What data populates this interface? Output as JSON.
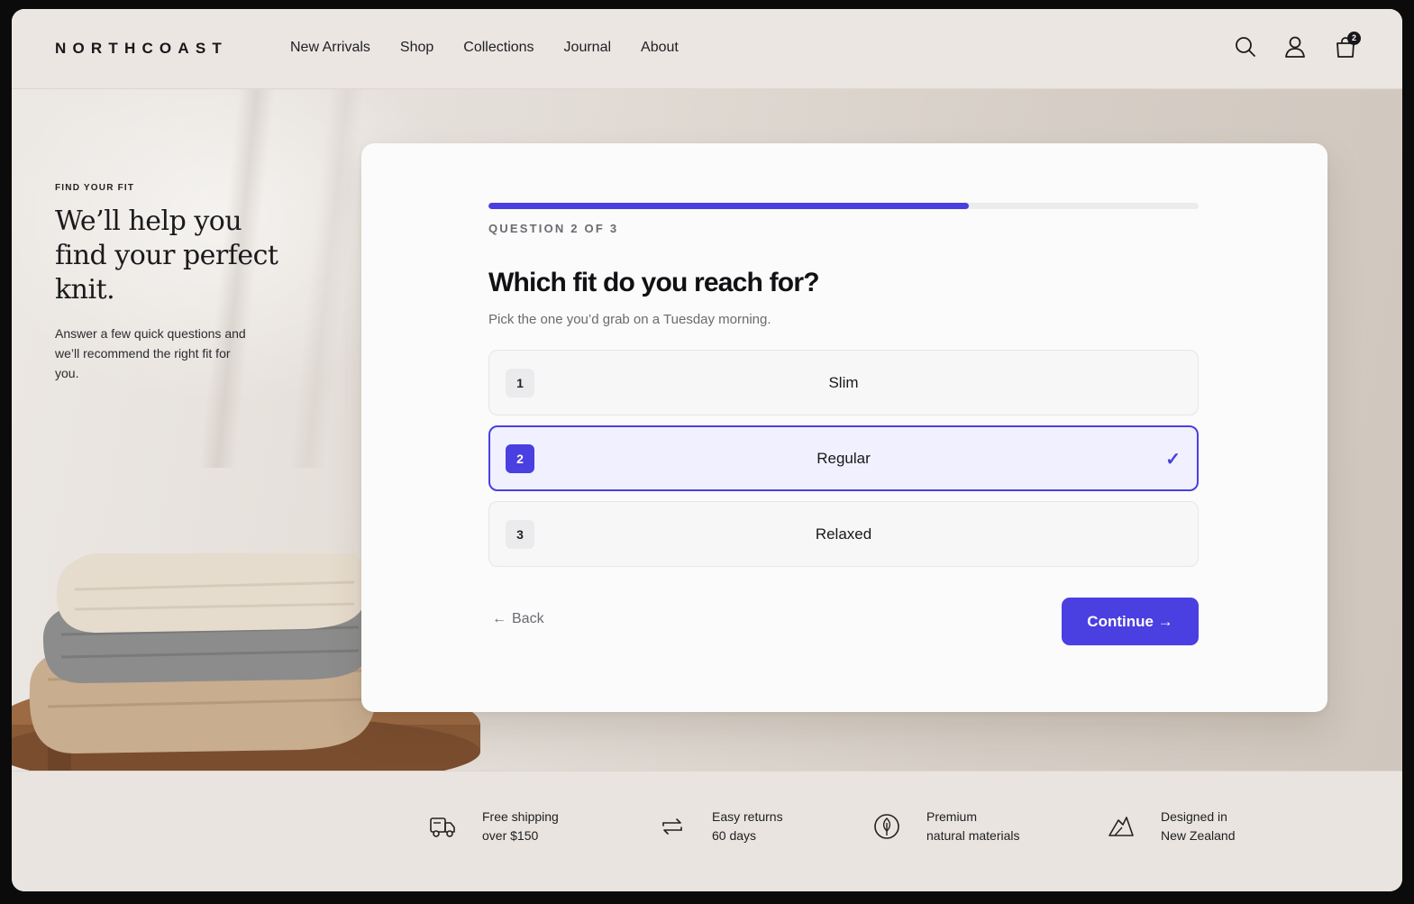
{
  "brand": {
    "logo": "NORTHCOAST"
  },
  "nav": {
    "items": [
      {
        "label": "New Arrivals"
      },
      {
        "label": "Shop"
      },
      {
        "label": "Collections"
      },
      {
        "label": "Journal"
      },
      {
        "label": "About"
      }
    ]
  },
  "header_icons": {
    "search": "search-icon",
    "account": "user-icon",
    "cart": "shopping-bag-icon",
    "cart_count": "2"
  },
  "intro": {
    "eyebrow": "FIND YOUR FIT",
    "title": "We’ll help you find your perfect knit.",
    "text": "Answer a few quick questions and we’ll recommend the right fit for you."
  },
  "quiz": {
    "progress_fraction": 0.676,
    "counter": "QUESTION 2 OF 3",
    "question": "Which fit do you reach for?",
    "subtitle": "Pick the one you’d grab on a Tuesday morning.",
    "options": [
      {
        "number": "1",
        "label": "Slim",
        "selected": false
      },
      {
        "number": "2",
        "label": "Regular",
        "selected": true,
        "check": "✓"
      },
      {
        "number": "3",
        "label": "Relaxed",
        "selected": false
      }
    ],
    "back_label": "Back",
    "back_arrow": "←",
    "continue_label": "Continue →"
  },
  "features": [
    {
      "icon": "truck-icon",
      "line1": "Free shipping",
      "line2": "over $150"
    },
    {
      "icon": "returns-icon",
      "line1": "Easy returns",
      "line2": "60 days"
    },
    {
      "icon": "leaf-icon",
      "line1": "Premium",
      "line2": "natural materials"
    },
    {
      "icon": "mountain-icon",
      "line1": "Designed in",
      "line2": "New Zealand"
    }
  ],
  "colors": {
    "accent": "#4a3fe0",
    "background": "#e9e4df",
    "card": "#fbfbfc"
  }
}
